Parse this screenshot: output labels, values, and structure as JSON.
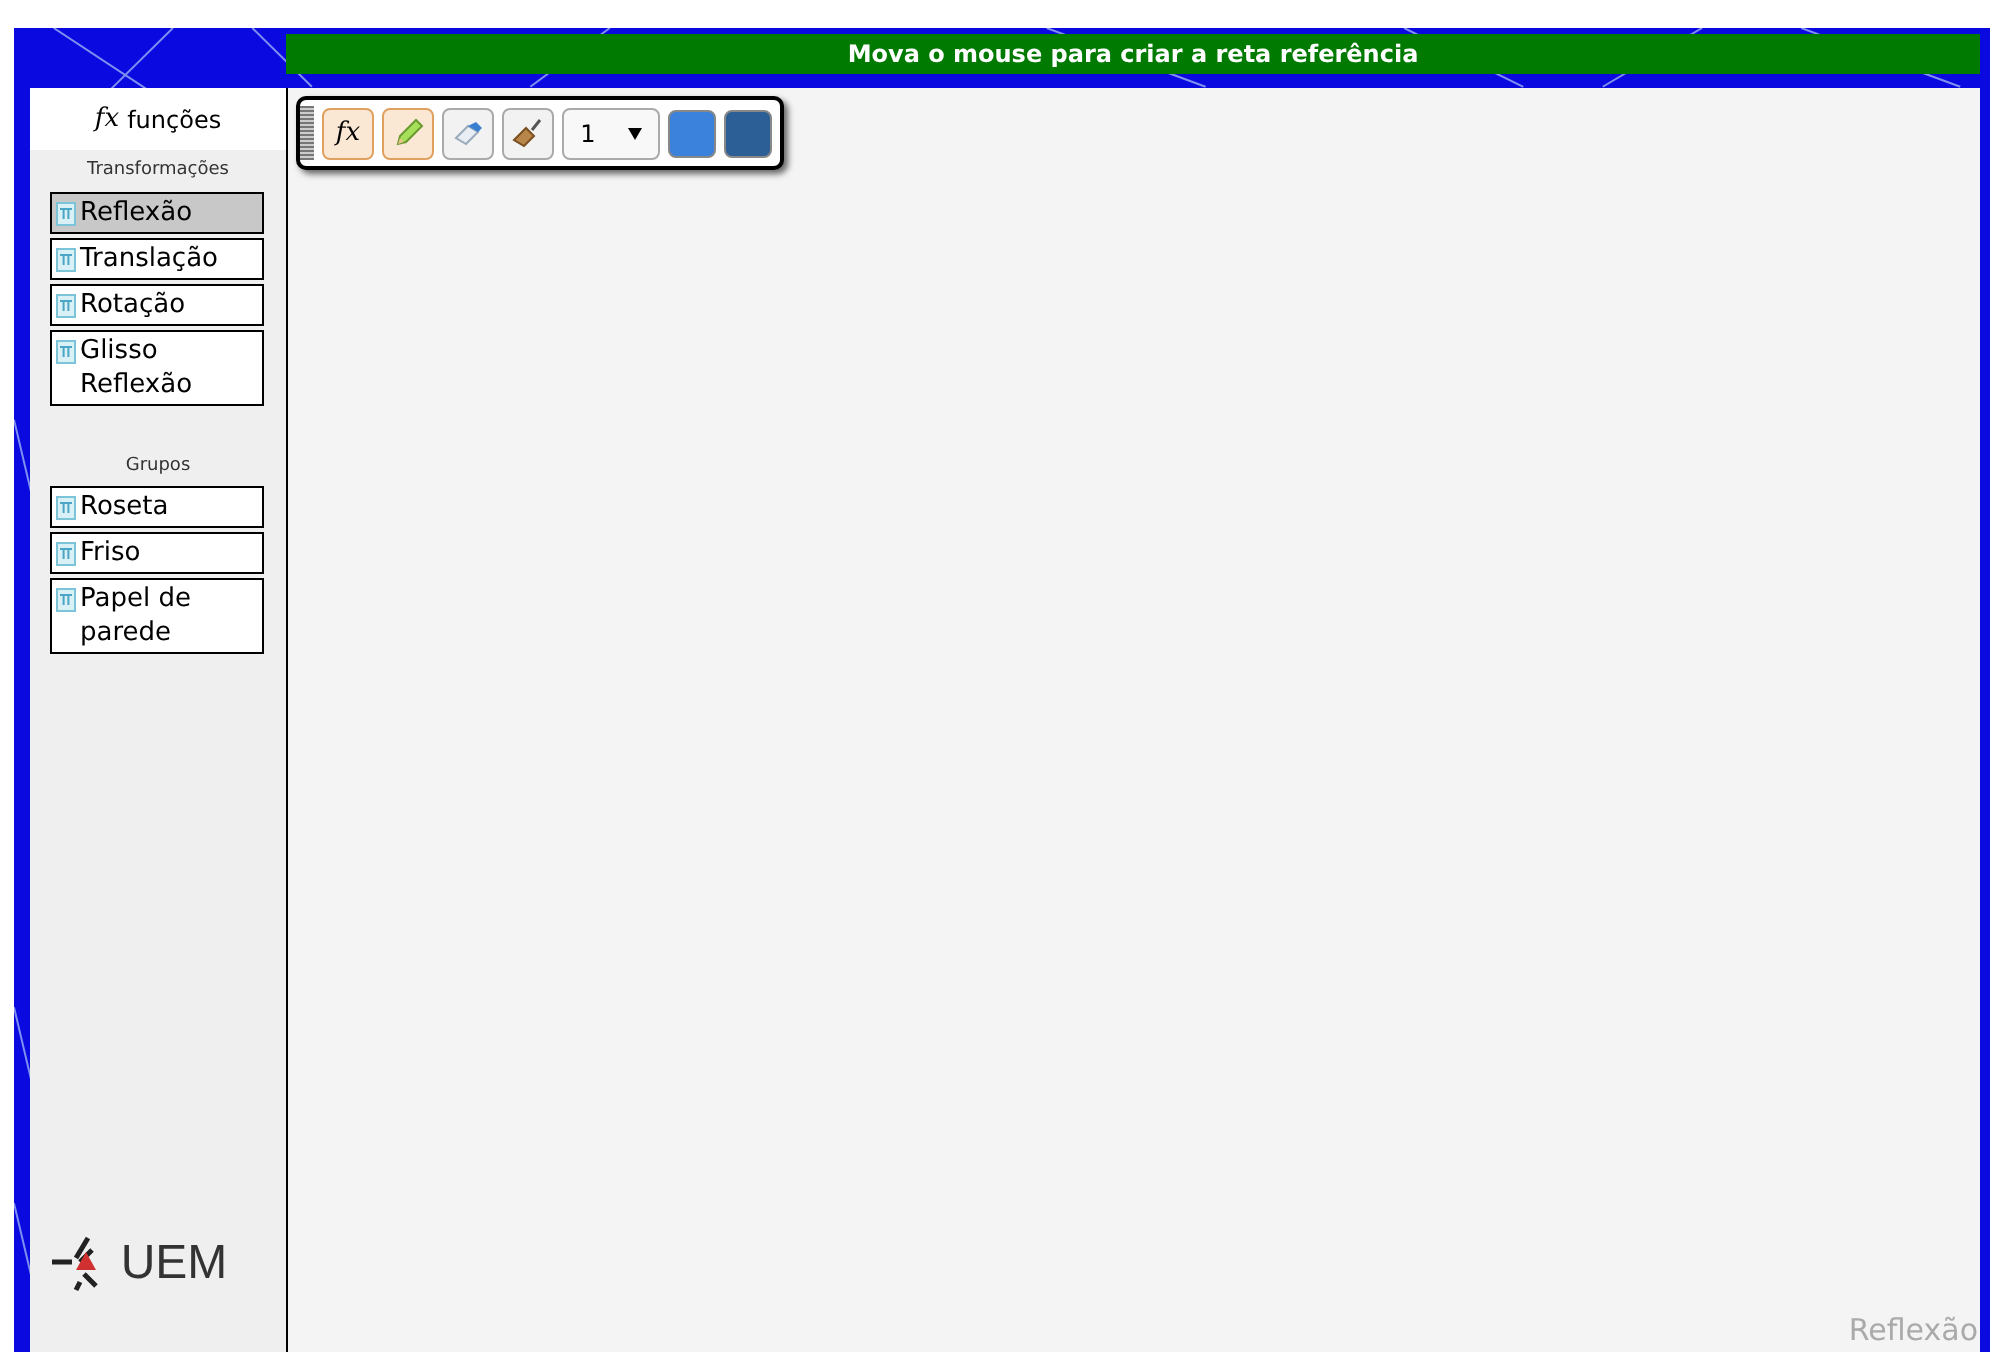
{
  "banner": {
    "text": "Mova o mouse para criar a reta referência"
  },
  "sidebar": {
    "header": {
      "icon_text": "fx",
      "label": "funções"
    },
    "sections": [
      {
        "title": "Transformações",
        "items": [
          {
            "label": "Reflexão",
            "selected": true
          },
          {
            "label": "Translação",
            "selected": false
          },
          {
            "label": "Rotação",
            "selected": false
          },
          {
            "label": "Glisso Reflexão",
            "selected": false
          }
        ]
      },
      {
        "title": "Grupos",
        "items": [
          {
            "label": "Roseta",
            "selected": false
          },
          {
            "label": "Friso",
            "selected": false
          },
          {
            "label": "Papel de parede",
            "selected": false
          }
        ]
      }
    ],
    "logo": {
      "text": "UEM"
    }
  },
  "toolbar": {
    "tools": [
      {
        "kind": "fx",
        "text": "fx",
        "active": true
      },
      {
        "kind": "pencil",
        "active": true
      },
      {
        "kind": "eraser",
        "active": false
      },
      {
        "kind": "broom",
        "active": false
      }
    ],
    "width_select": {
      "value": "1"
    },
    "colors": [
      {
        "color": "#3b82dc"
      },
      {
        "color": "#2c5f96"
      }
    ]
  },
  "canvas": {
    "mode_label": "Reflexão"
  }
}
